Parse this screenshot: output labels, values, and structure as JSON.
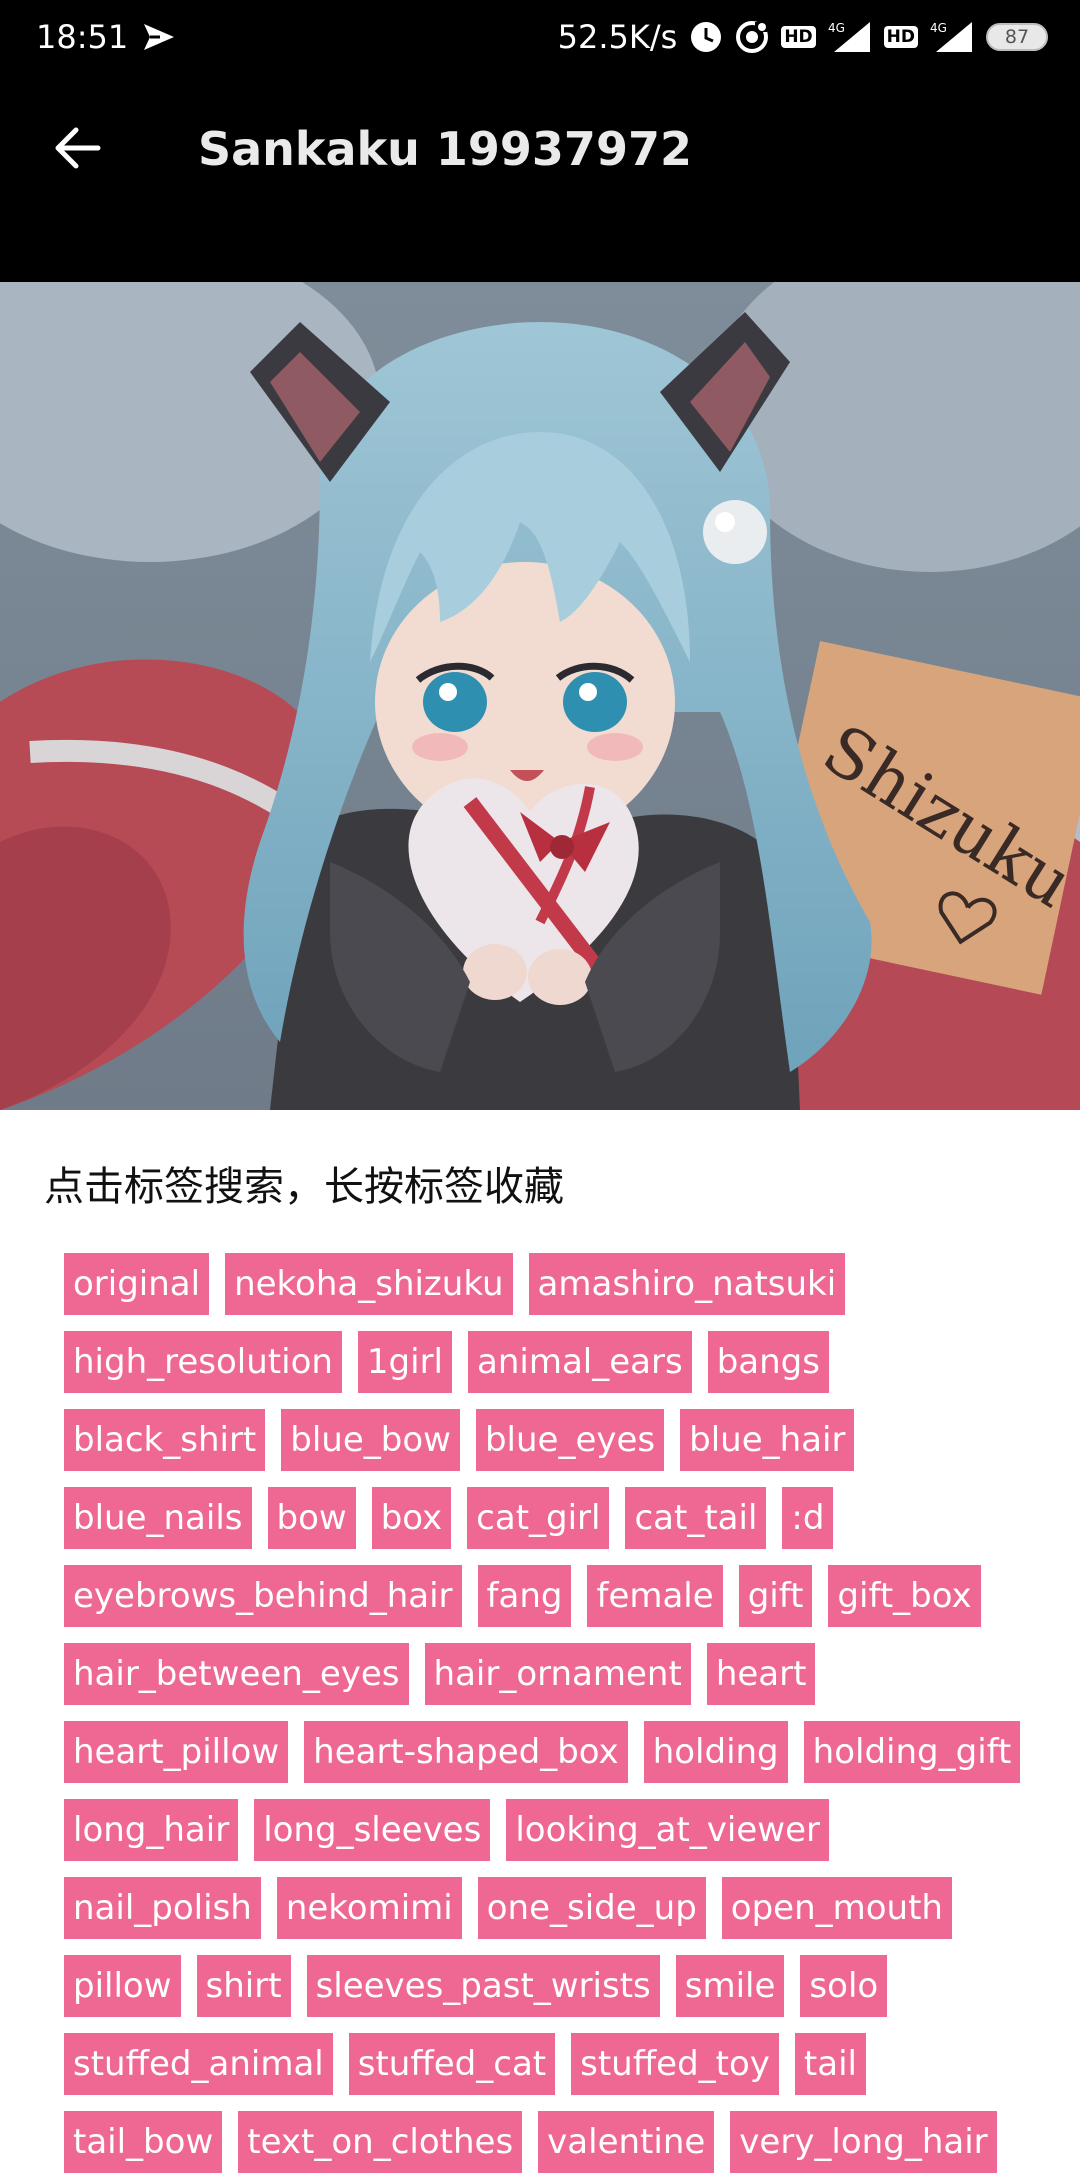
{
  "status_bar": {
    "time": "18:51",
    "net_speed": "52.5K/s",
    "battery": "87",
    "icons": [
      "send-arrow-icon",
      "alarm-icon",
      "vpn-icon",
      "hd-icon",
      "signal-4g-icon",
      "hd-icon",
      "signal-4g-icon",
      "battery-icon"
    ],
    "signal_label": "4G",
    "hd_label": "HD"
  },
  "app_bar": {
    "title": "Sankaku 19937972",
    "back_icon": "arrow-back-icon"
  },
  "image": {
    "sign_text": "Shizuku"
  },
  "hint": "点击标签搜索，长按标签收藏",
  "tags": [
    "original",
    "nekoha_shizuku",
    "amashiro_natsuki",
    "high_resolution",
    "1girl",
    "animal_ears",
    "bangs",
    "black_shirt",
    "blue_bow",
    "blue_eyes",
    "blue_hair",
    "blue_nails",
    "bow",
    "box",
    "cat_girl",
    "cat_tail",
    ":d",
    "eyebrows_behind_hair",
    "fang",
    "female",
    "gift",
    "gift_box",
    "hair_between_eyes",
    "hair_ornament",
    "heart",
    "heart_pillow",
    "heart-shaped_box",
    "holding",
    "holding_gift",
    "long_hair",
    "long_sleeves",
    "looking_at_viewer",
    "nail_polish",
    "nekomimi",
    "one_side_up",
    "open_mouth",
    "pillow",
    "shirt",
    "sleeves_past_wrists",
    "smile",
    "solo",
    "stuffed_animal",
    "stuffed_cat",
    "stuffed_toy",
    "tail",
    "tail_bow",
    "text_on_clothes",
    "valentine",
    "very_long_hair"
  ],
  "colors": {
    "tag_bg": "#ef6894",
    "bar_bg": "#000000"
  }
}
